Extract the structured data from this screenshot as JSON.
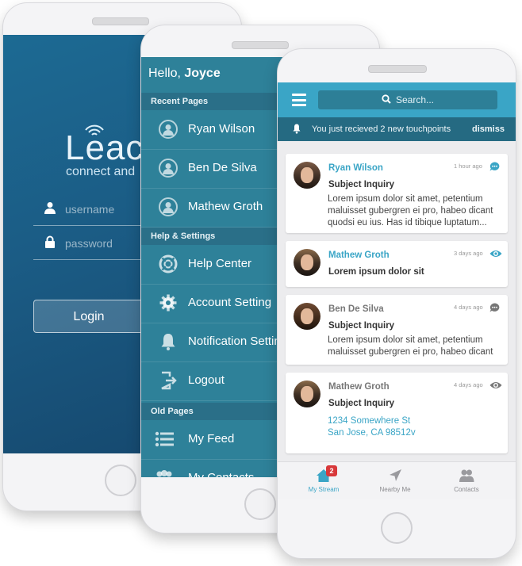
{
  "login": {
    "logo_text": "Leac",
    "tagline": "connect and",
    "username_placeholder": "username",
    "password_placeholder": "password",
    "login_button": "Login"
  },
  "menu": {
    "greeting": "Hello,",
    "user_name": "Joyce",
    "sections": [
      {
        "title": "Recent Pages"
      },
      {
        "title": "Help & Settings"
      },
      {
        "title": "Old Pages"
      }
    ],
    "recent": [
      {
        "label": "Ryan Wilson",
        "icon": "user-avatar-icon"
      },
      {
        "label": "Ben De Silva",
        "icon": "user-avatar-icon"
      },
      {
        "label": "Mathew Groth",
        "icon": "user-avatar-icon"
      }
    ],
    "help": [
      {
        "label": "Help Center",
        "icon": "lifebuoy-icon"
      },
      {
        "label": "Account Setting",
        "icon": "gear-icon"
      },
      {
        "label": "Notification Setting",
        "icon": "bell-icon"
      },
      {
        "label": "Logout",
        "icon": "logout-icon"
      }
    ],
    "old": [
      {
        "label": "My Feed",
        "icon": "list-icon"
      },
      {
        "label": "My Contacts",
        "icon": "contacts-icon"
      }
    ]
  },
  "stream": {
    "search_placeholder": "Search...",
    "notification": "You just recieved 2 new touchpoints",
    "dismiss": "dismiss",
    "accent_color": "#3aa5c6",
    "cards": [
      {
        "name": "Ryan Wilson",
        "time": "1 hour ago",
        "status_icon": "chat-bubble-icon",
        "subject": "Subject Inquiry",
        "body": "Lorem ipsum dolor sit amet, petentium maluisset gubergren ei pro, habeo dicant quodsi eu ius. Has id tibique luptatum..."
      },
      {
        "name": "Mathew Groth",
        "time": "3 days ago",
        "status_icon": "eye-icon",
        "subject": "Lorem ipsum dolor sit",
        "body": ""
      },
      {
        "name": "Ben De Silva",
        "time": "4 days ago",
        "status_icon": "chat-bubble-icon",
        "subject": "Subject Inquiry",
        "body": "Lorem ipsum dolor sit amet, petentium maluisset gubergren ei pro, habeo dicant"
      },
      {
        "name": "Mathew Groth",
        "time": "4 days ago",
        "status_icon": "eye-icon",
        "subject": "Subject Inquiry",
        "address_line1": "1234 Somewhere St",
        "address_line2": "San Jose, CA 98512v"
      }
    ],
    "tabs": [
      {
        "label": "My Stream",
        "icon": "home-icon",
        "badge": "2"
      },
      {
        "label": "Nearby Me",
        "icon": "location-arrow-icon"
      },
      {
        "label": "Contacts",
        "icon": "contacts-icon"
      }
    ]
  }
}
